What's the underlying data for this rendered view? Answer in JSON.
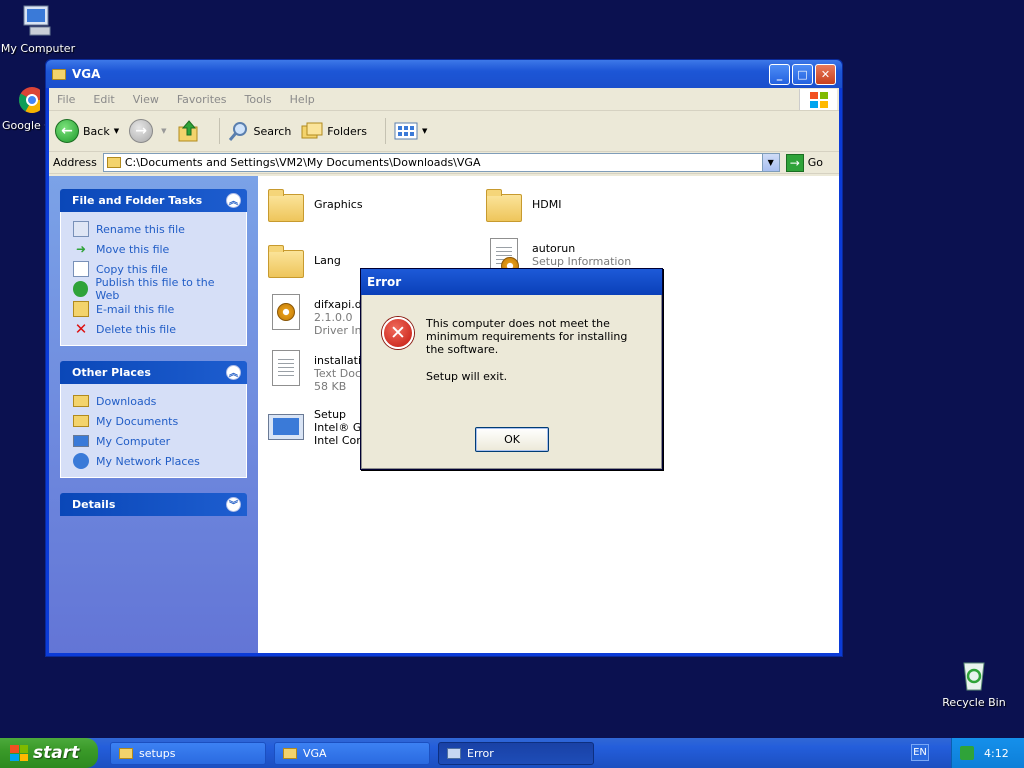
{
  "desktop": {
    "icons": [
      {
        "label": "My Computer"
      },
      {
        "label": "Google C"
      },
      {
        "label": "Recycle Bin"
      }
    ]
  },
  "window": {
    "title": "VGA",
    "menu": [
      "File",
      "Edit",
      "View",
      "Favorites",
      "Tools",
      "Help"
    ],
    "toolbar": {
      "back": "Back",
      "search": "Search",
      "folders": "Folders"
    },
    "address": {
      "label": "Address",
      "value": "C:\\Documents and Settings\\VM2\\My Documents\\Downloads\\VGA",
      "go": "Go"
    }
  },
  "taskpane": {
    "file_tasks": {
      "title": "File and Folder Tasks",
      "items": [
        "Rename this file",
        "Move this file",
        "Copy this file",
        "Publish this file to the Web",
        "E-mail this file",
        "Delete this file"
      ]
    },
    "other_places": {
      "title": "Other Places",
      "items": [
        "Downloads",
        "My Documents",
        "My Computer",
        "My Network Places"
      ]
    },
    "details": {
      "title": "Details"
    }
  },
  "files": [
    {
      "name": "Graphics"
    },
    {
      "name": "HDMI"
    },
    {
      "name": "Lang"
    },
    {
      "name": "autorun",
      "sub1": "Setup Information"
    },
    {
      "name": "difxapi.dll",
      "sub1": "2.1.0.0",
      "sub2": "Driver Ins"
    },
    {
      "name": "installatio",
      "sub1": "Text Docu",
      "sub2": "58 KB"
    },
    {
      "name": "Setup",
      "sub1": "Intel® Gr",
      "sub2": "Intel Corp"
    }
  ],
  "dialog": {
    "title": "Error",
    "message": "This computer does not meet the minimum requirements for installing the software.",
    "message2": "Setup will exit.",
    "ok": "OK"
  },
  "taskbar": {
    "start": "start",
    "tasks": [
      "setups",
      "VGA",
      "Error"
    ],
    "lang": "EN",
    "time": "4:12"
  }
}
